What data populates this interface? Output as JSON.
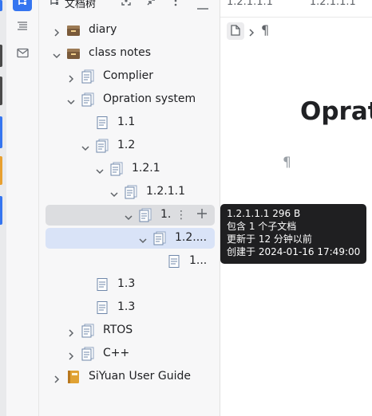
{
  "panel": {
    "title": "文档树"
  },
  "tree": {
    "rows": [
      {
        "label": "diary",
        "icon": "box-icon",
        "expanded": false
      },
      {
        "label": "class notes",
        "icon": "box-icon",
        "expanded": true
      },
      {
        "label": "Complier",
        "icon": "doc-stack-icon",
        "expanded": false
      },
      {
        "label": "Opration system",
        "icon": "doc-stack-icon",
        "expanded": true
      },
      {
        "label": "1.1",
        "icon": "doc-icon"
      },
      {
        "label": "1.2",
        "icon": "doc-stack-icon",
        "expanded": true
      },
      {
        "label": "1.2.1",
        "icon": "doc-stack-icon",
        "expanded": true
      },
      {
        "label": "1.2.1.1",
        "icon": "doc-stack-icon",
        "expanded": true
      },
      {
        "label": "1.",
        "icon": "doc-stack-icon",
        "expanded": true,
        "state": "hover"
      },
      {
        "label": "1.2....",
        "icon": "doc-stack-icon",
        "expanded": true,
        "state": "selected"
      },
      {
        "label": "1...",
        "icon": "doc-icon"
      },
      {
        "label": "1.3",
        "icon": "doc-icon"
      },
      {
        "label": "1.3",
        "icon": "doc-icon"
      },
      {
        "label": "RTOS",
        "icon": "doc-stack-icon",
        "expanded": false
      },
      {
        "label": "C++",
        "icon": "doc-stack-icon",
        "expanded": false
      },
      {
        "label": "SiYuan User Guide",
        "icon": "notebook-icon",
        "expanded": false
      }
    ]
  },
  "editor": {
    "breadcrumb_top": [
      "1.2.1.1.1",
      "1.2.1.1.1"
    ],
    "breadcrumb_pilcrow": "¶",
    "title": "Oprat",
    "paragraph_mark": "¶"
  },
  "tooltip": {
    "line1": "1.2.1.1.1 296 B",
    "line2": "包含 1 个子文档",
    "line3": "更新于 12 分钟以前",
    "line4": "创建于 2024-01-16 17:49:00"
  },
  "colors": {
    "accent": "#3575f0",
    "selected_row": "#d9e3f7",
    "hover_row": "#dcdde0",
    "tooltip_bg": "#1f1f21"
  }
}
